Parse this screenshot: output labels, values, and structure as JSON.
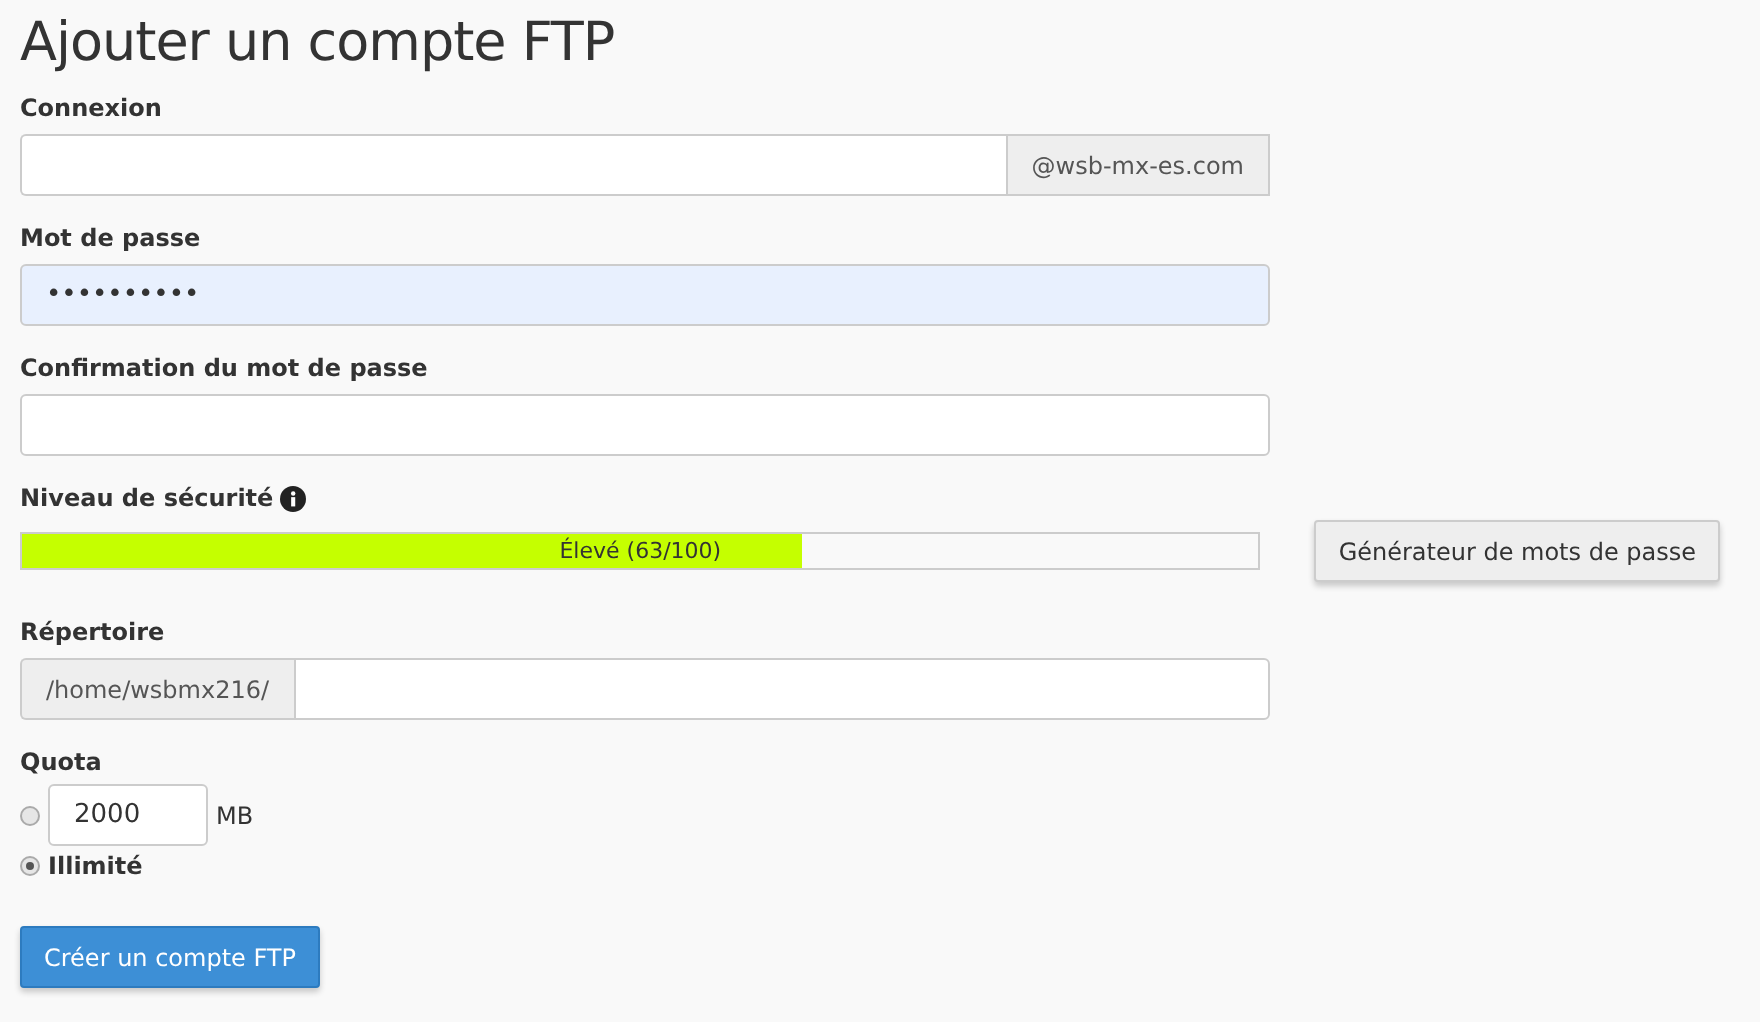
{
  "title": "Ajouter un compte FTP",
  "login": {
    "label": "Connexion",
    "domain": "@wsb-mx-es.com"
  },
  "password": {
    "label": "Mot de passe",
    "value": "••••••••••",
    "autofilled": true
  },
  "confirm": {
    "label": "Confirmation du mot de passe"
  },
  "strength": {
    "label": "Niveau de sécurité",
    "level": 0.63,
    "reading": "Élevé (63/100)",
    "generator_button": "Générateur de mots de passe"
  },
  "directory": {
    "label": "Répertoire",
    "prefix": "/home/wsbmx216/"
  },
  "quota": {
    "label": "Quota",
    "options": [
      {
        "kind": "amount",
        "value": "2000",
        "unit": "MB",
        "selected": false
      },
      {
        "kind": "unlimited",
        "label": "Illimité",
        "selected": true
      }
    ]
  },
  "submit_button": "Créer un compte FTP"
}
